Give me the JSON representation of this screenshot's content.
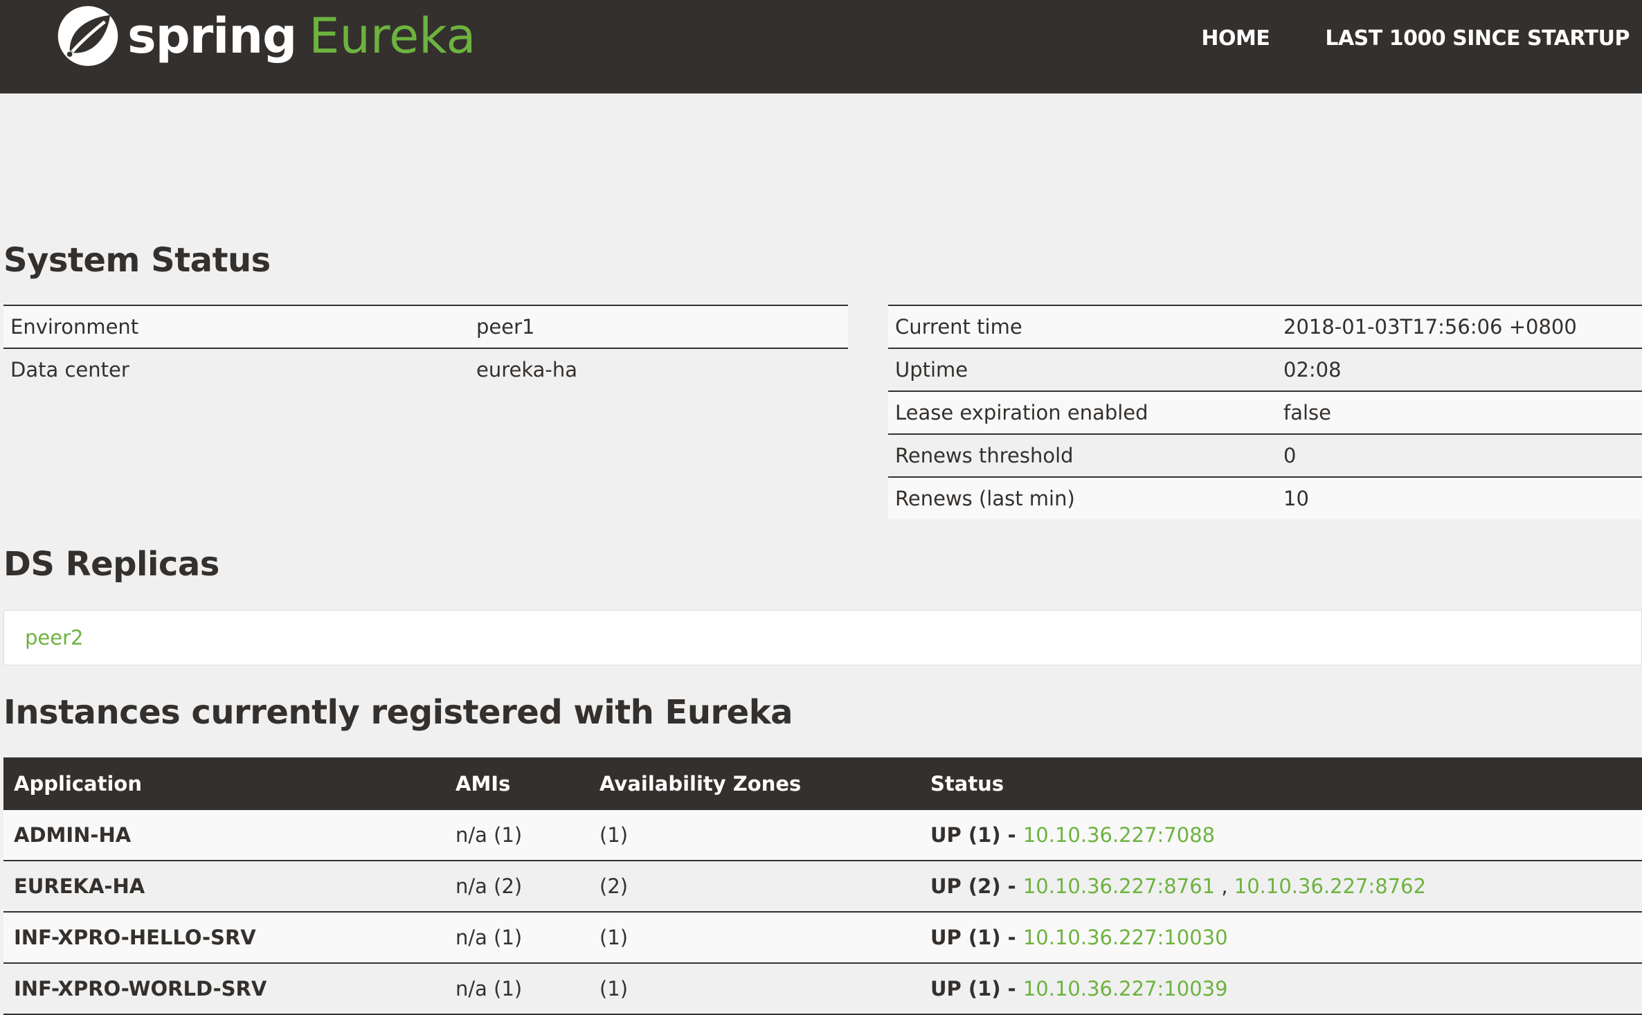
{
  "nav": {
    "brand_spring": "spring",
    "brand_eureka": "Eureka",
    "links": [
      "HOME",
      "LAST 1000 SINCE STARTUP"
    ]
  },
  "system_status": {
    "title": "System Status",
    "left": [
      {
        "key": "Environment",
        "value": "peer1"
      },
      {
        "key": "Data center",
        "value": "eureka-ha"
      }
    ],
    "right": [
      {
        "key": "Current time",
        "value": "2018-01-03T17:56:06 +0800"
      },
      {
        "key": "Uptime",
        "value": "02:08"
      },
      {
        "key": "Lease expiration enabled",
        "value": "false"
      },
      {
        "key": "Renews threshold",
        "value": "0"
      },
      {
        "key": "Renews (last min)",
        "value": "10"
      }
    ]
  },
  "replicas": {
    "title": "DS Replicas",
    "items": [
      "peer2"
    ]
  },
  "instances": {
    "title": "Instances currently registered with Eureka",
    "headers": [
      "Application",
      "AMIs",
      "Availability Zones",
      "Status"
    ],
    "rows": [
      {
        "app": "ADMIN-HA",
        "amis": "n/a (1)",
        "zones": "(1)",
        "status": "UP (1) - ",
        "links": [
          "10.10.36.227:7088"
        ]
      },
      {
        "app": "EUREKA-HA",
        "amis": "n/a (2)",
        "zones": "(2)",
        "status": "UP (2) - ",
        "links": [
          "10.10.36.227:8761",
          "10.10.36.227:8762"
        ]
      },
      {
        "app": "INF-XPRO-HELLO-SRV",
        "amis": "n/a (1)",
        "zones": "(1)",
        "status": "UP (1) - ",
        "links": [
          "10.10.36.227:10030"
        ]
      },
      {
        "app": "INF-XPRO-WORLD-SRV",
        "amis": "n/a (1)",
        "zones": "(1)",
        "status": "UP (1) - ",
        "links": [
          "10.10.36.227:10039"
        ]
      }
    ],
    "link_separator": " , "
  },
  "colors": {
    "navbar": "#34302d",
    "accent_green": "#6db33f",
    "background": "#f0f0f0"
  },
  "icons": {
    "logo": "spring-leaf-icon"
  }
}
